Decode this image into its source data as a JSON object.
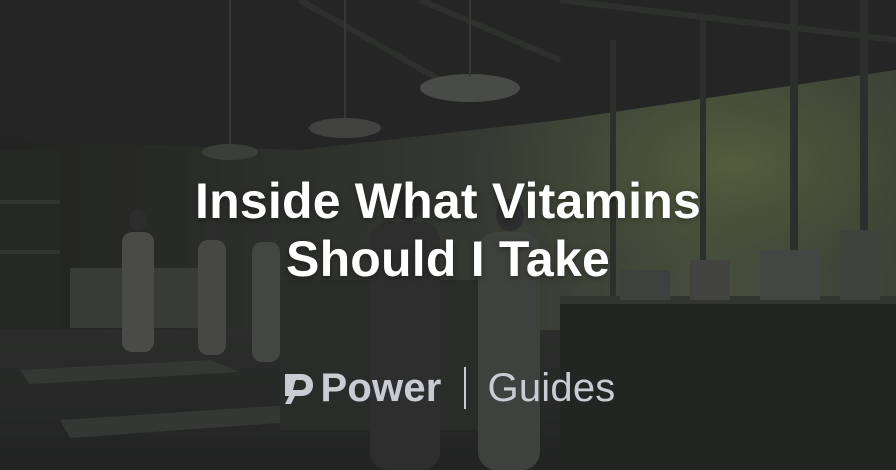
{
  "title": {
    "line1": "Inside What Vitamins",
    "line2": "Should I Take"
  },
  "brand": {
    "logo_icon": "power-logo-icon",
    "name": "Power",
    "separator": "|",
    "section": "Guides"
  },
  "colors": {
    "title_text": "#ffffff",
    "brand_text": "#c9ccd3",
    "overlay": "#161818"
  }
}
